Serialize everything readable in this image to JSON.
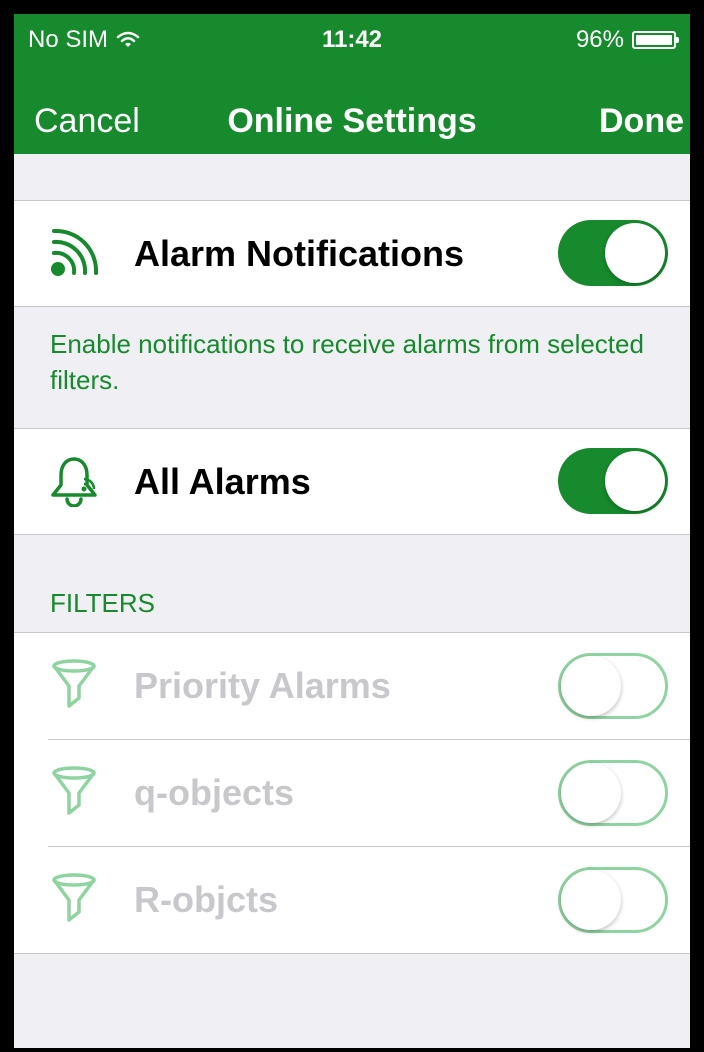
{
  "status_bar": {
    "carrier": "No SIM",
    "wifi_icon": "wifi-icon",
    "time": "11:42",
    "battery_percent": "96%",
    "battery_level": 0.96,
    "battery_icon": "battery-icon"
  },
  "nav": {
    "cancel_label": "Cancel",
    "title": "Online Settings",
    "done_label": "Done"
  },
  "alarm_notifications": {
    "label": "Alarm Notifications",
    "icon": "broadcast-icon",
    "enabled": true,
    "footer": "Enable notifications to receive alarms from selected filters."
  },
  "all_alarms": {
    "label": "All Alarms",
    "icon": "bell-icon",
    "enabled": true
  },
  "filters": {
    "header": "FILTERS",
    "items": [
      {
        "label": "Priority Alarms",
        "icon": "filter-icon",
        "enabled": false
      },
      {
        "label": "q-objects",
        "icon": "filter-icon",
        "enabled": false
      },
      {
        "label": "R-objcts",
        "icon": "filter-icon",
        "enabled": false
      }
    ]
  },
  "colors": {
    "accent": "#168a2c",
    "disabled_text": "#c7c7cc",
    "toggle_off_border": "#8fd4a0",
    "background": "#efeff4"
  }
}
